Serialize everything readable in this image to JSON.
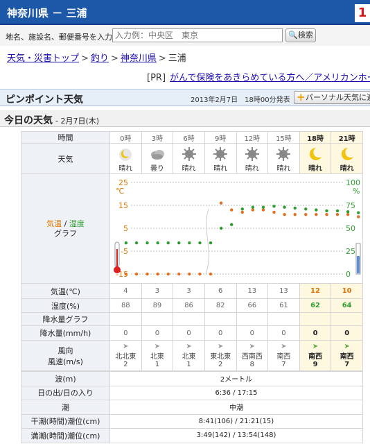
{
  "header": {
    "title": "神奈川県 － 三浦",
    "badge": "1"
  },
  "search": {
    "label": "地名、施設名、郵便番号を入力",
    "placeholder": "入力例：中央区　東京",
    "button": "検索"
  },
  "breadcrumb": [
    "天気・災害トップ",
    "釣り",
    "神奈川県",
    "三浦"
  ],
  "pr": {
    "tag": "[PR]",
    "link": "がんで保険をあきらめている方へ／アメリカンホーム"
  },
  "pinpoint": {
    "heading": "ピンポイント天気",
    "issued": "2013年2月7日　18時00分発表",
    "personal_button": "パーソナル天気に追"
  },
  "today": {
    "heading": "今日の天気",
    "date": "- 2月7日(木)"
  },
  "labels": {
    "time": "時間",
    "weather": "天気",
    "graph_temp": "気温",
    "graph_slash": " / ",
    "graph_hum": "湿度",
    "graph_word": "グラフ",
    "temp": "気温(℃)",
    "humidity": "湿度(%)",
    "precip_graph": "降水量グラフ",
    "precip": "降水量(mm/h)",
    "wind_line1": "風向",
    "wind_line2": "風速(m/s)"
  },
  "hours": [
    {
      "time": "0時",
      "icon": "clear-night-icon",
      "weather": "晴れ",
      "temp": "4",
      "hum": "88",
      "precip": "0",
      "dir": "北北東",
      "speed": "2",
      "night": false
    },
    {
      "time": "3時",
      "icon": "cloudy-icon",
      "weather": "曇り",
      "temp": "3",
      "hum": "89",
      "precip": "0",
      "dir": "北東",
      "speed": "1",
      "night": false
    },
    {
      "time": "6時",
      "icon": "sun-icon",
      "weather": "晴れ",
      "temp": "3",
      "hum": "86",
      "precip": "0",
      "dir": "北東",
      "speed": "1",
      "night": false
    },
    {
      "time": "9時",
      "icon": "sun-icon",
      "weather": "晴れ",
      "temp": "6",
      "hum": "82",
      "precip": "0",
      "dir": "東北東",
      "speed": "2",
      "night": false
    },
    {
      "time": "12時",
      "icon": "sun-icon",
      "weather": "晴れ",
      "temp": "13",
      "hum": "66",
      "precip": "0",
      "dir": "西南西",
      "speed": "8",
      "night": false
    },
    {
      "time": "15時",
      "icon": "sun-icon",
      "weather": "晴れ",
      "temp": "13",
      "hum": "61",
      "precip": "0",
      "dir": "南西",
      "speed": "7",
      "night": false
    },
    {
      "time": "18時",
      "icon": "moon-icon",
      "weather": "晴れ",
      "temp": "12",
      "hum": "62",
      "precip": "0",
      "dir": "南西",
      "speed": "9",
      "night": true
    },
    {
      "time": "21時",
      "icon": "moon-icon",
      "weather": "晴れ",
      "temp": "10",
      "hum": "64",
      "precip": "0",
      "dir": "南西",
      "speed": "7",
      "night": true
    }
  ],
  "chart_data": {
    "type": "line",
    "x": [
      "0時",
      "3時",
      "6時",
      "9時",
      "12時",
      "15時",
      "18時",
      "21時"
    ],
    "y_left_unit": "℃",
    "y_left_ticks": [
      25,
      15,
      5,
      -5,
      -15
    ],
    "y_right_unit": "%",
    "y_right_ticks": [
      100,
      75,
      50,
      25,
      0
    ],
    "ylim_left": [
      -15,
      25
    ],
    "ylim_right": [
      0,
      100
    ],
    "series": [
      {
        "name": "気温",
        "color": "#e0701e",
        "values": [
          4,
          3,
          3,
          6,
          13,
          13,
          12,
          10
        ]
      },
      {
        "name": "湿度",
        "color": "#2f9c2f",
        "values": [
          88,
          89,
          86,
          82,
          66,
          61,
          62,
          64
        ]
      }
    ],
    "series_points": [
      {
        "name": "気温",
        "points": [
          [
            0,
            -15
          ],
          [
            0.33,
            -15
          ],
          [
            0.67,
            -15
          ],
          [
            1,
            -15
          ],
          [
            1.33,
            -15
          ],
          [
            1.67,
            -15
          ],
          [
            2,
            -15
          ],
          [
            2.33,
            -15
          ],
          [
            2.67,
            -15
          ],
          [
            3,
            16
          ],
          [
            3.33,
            13
          ],
          [
            3.67,
            12
          ],
          [
            4,
            13
          ],
          [
            4.33,
            13
          ],
          [
            4.67,
            12
          ],
          [
            5,
            11
          ],
          [
            5.33,
            11
          ],
          [
            5.67,
            11
          ],
          [
            6,
            11
          ],
          [
            6.33,
            11
          ],
          [
            6.67,
            11
          ],
          [
            7,
            11
          ],
          [
            7.33,
            10
          ]
        ]
      },
      {
        "name": "湿度",
        "points": [
          [
            0,
            34
          ],
          [
            0.33,
            34
          ],
          [
            0.67,
            34
          ],
          [
            1,
            34
          ],
          [
            1.33,
            34
          ],
          [
            1.67,
            34
          ],
          [
            2,
            34
          ],
          [
            2.33,
            34
          ],
          [
            2.67,
            34
          ],
          [
            3,
            50
          ],
          [
            3.33,
            54
          ],
          [
            3.67,
            71
          ],
          [
            4,
            73
          ],
          [
            4.33,
            73
          ],
          [
            4.67,
            74
          ],
          [
            5,
            73
          ],
          [
            5.33,
            72
          ],
          [
            5.67,
            71
          ],
          [
            6,
            70
          ],
          [
            6.33,
            69
          ],
          [
            6.67,
            69
          ],
          [
            7,
            68
          ],
          [
            7.33,
            67
          ]
        ]
      }
    ]
  },
  "info": [
    {
      "label": "波(m)",
      "value": "2メートル"
    },
    {
      "label": "日の出/日の入り",
      "value": "6:36 / 17:15"
    },
    {
      "label": "潮",
      "value": "中潮"
    },
    {
      "label": "干潮(時間)潮位(cm)",
      "value": "8:41(106) / 21:21(15)"
    },
    {
      "label": "満潮(時間)潮位(cm)",
      "value": "3:49(142) / 13:54(148)"
    }
  ]
}
